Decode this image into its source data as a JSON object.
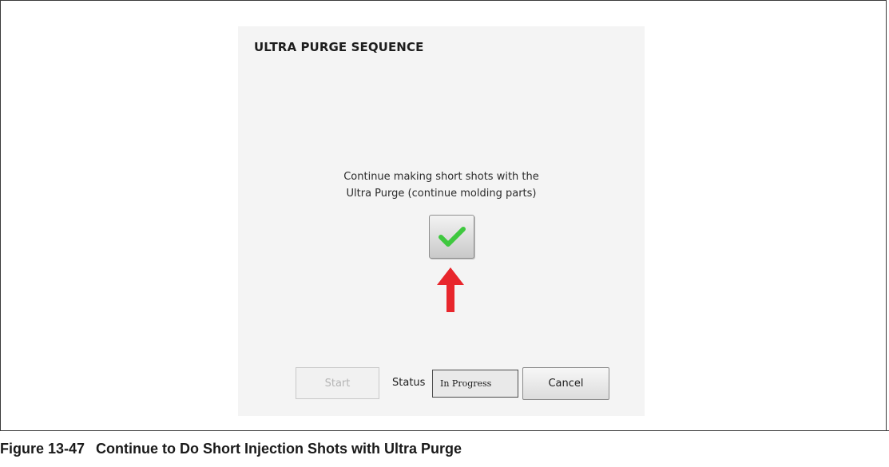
{
  "dialog": {
    "title": "ULTRA PURGE SEQUENCE",
    "message_line1": "Continue making short shots with the",
    "message_line2": "Ultra Purge (continue molding parts)",
    "confirm_icon": "checkmark-icon",
    "pointer_icon": "red-arrow-up-icon",
    "start_label": "Start",
    "status_label": "Status",
    "status_value": "In Progress",
    "cancel_label": "Cancel"
  },
  "caption": {
    "number": "Figure 13-47",
    "text": "Continue to Do Short Injection Shots with Ultra Purge"
  },
  "colors": {
    "checkmark": "#3fc83f",
    "arrow": "#e8262c",
    "dialog_background": "#f4f4f4"
  }
}
